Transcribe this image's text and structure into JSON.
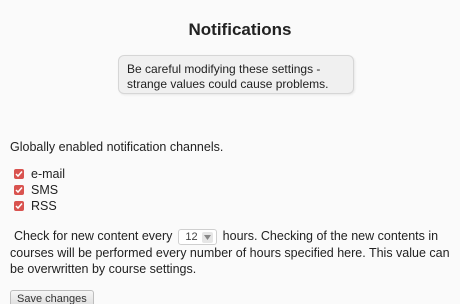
{
  "page": {
    "title": "Notifications",
    "warning": "Be careful modifying these settings - strange values could cause problems.",
    "intro": "Globally enabled notification channels."
  },
  "channels": [
    {
      "label": "e-mail",
      "checked": true
    },
    {
      "label": "SMS",
      "checked": true
    },
    {
      "label": "RSS",
      "checked": true
    }
  ],
  "frequency": {
    "before": "Check for new content every",
    "value": "12",
    "after": "hours.  Checking of the new contents in courses will be performed every number of hours specified here. This value can be overwritten by course settings."
  },
  "actions": {
    "save_label": "Save changes"
  },
  "colors": {
    "checkbox": "#d9534f"
  }
}
